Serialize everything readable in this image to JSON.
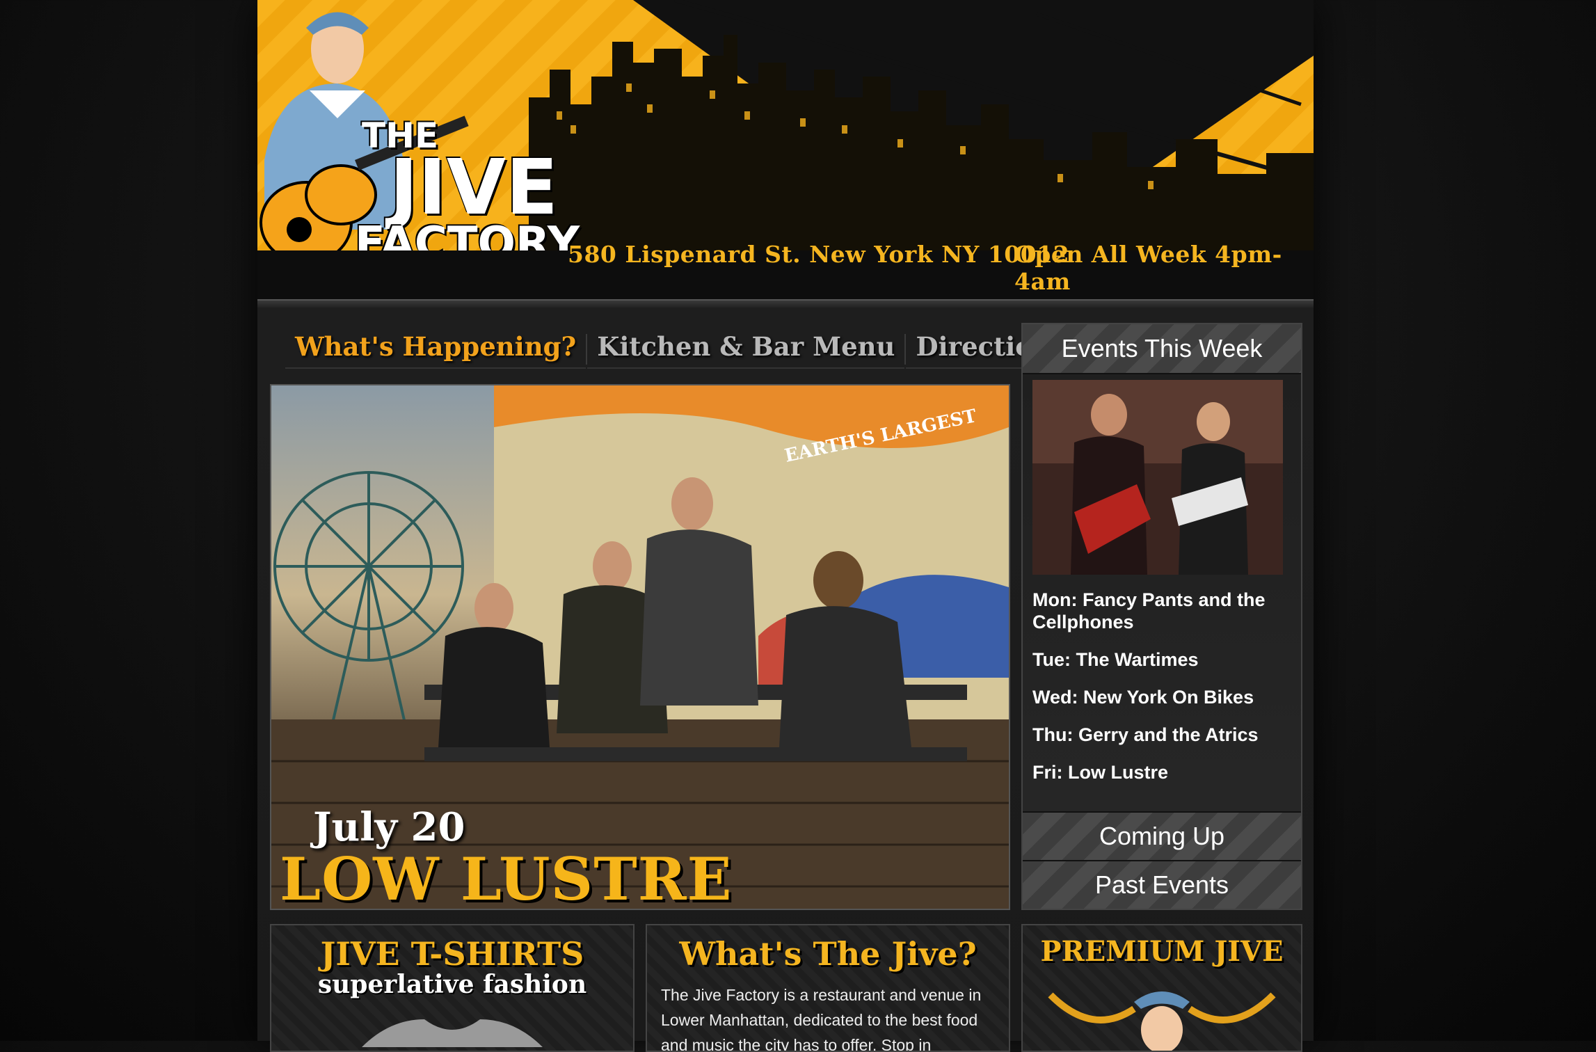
{
  "header": {
    "logo": {
      "line1": "THE",
      "line2": "JIVE",
      "line3": "FACTORY"
    },
    "address": "580 Lispenard St. New York NY 10012",
    "hours": "Open All Week 4pm-4am"
  },
  "nav": {
    "items": [
      {
        "label": "What's Happening?"
      },
      {
        "label": "Kitchen & Bar Menu"
      },
      {
        "label": "Directions"
      }
    ]
  },
  "hero": {
    "date": "July 20",
    "title": "LOW LUSTRE",
    "mural_text": "THE EARTH'S LARGEST NEARLY CLEARLY VISIBLE"
  },
  "sidebar": {
    "title": "Events This Week",
    "events": [
      "Mon: Fancy Pants and the Cellphones",
      "Tue: The Wartimes",
      "Wed: New York On Bikes",
      "Thu: Gerry and the Atrics",
      "Fri: Low Lustre"
    ],
    "coming_up": "Coming Up",
    "past_events": "Past Events"
  },
  "panels": {
    "tshirts": {
      "title": "JIVE T-SHIRTS",
      "subtitle": "superlative fashion"
    },
    "about": {
      "title": "What's The Jive?",
      "text": "The Jive Factory is a restaurant and venue in Lower Manhattan, dedicated to the best food and music the city has to offer. Stop in"
    },
    "premium": {
      "title": "PREMIUM JIVE"
    }
  },
  "colors": {
    "accent": "#f5b520",
    "background": "#151515"
  }
}
